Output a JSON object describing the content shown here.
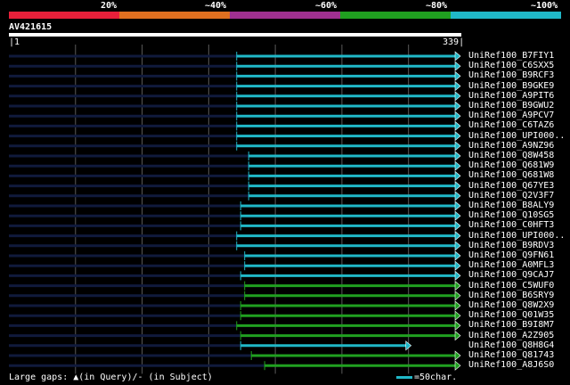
{
  "legend": {
    "labels": [
      "20%",
      "~40%",
      "~60%",
      "~80%",
      "~100%"
    ],
    "colors": [
      "#e8203a",
      "#e07020",
      "#a03090",
      "#20a020",
      "#20b8c8"
    ]
  },
  "query": {
    "name": "AV421615",
    "start": "1",
    "end": "339"
  },
  "colors": {
    "teal": "#20b8c8",
    "green": "#20a020",
    "gap": "#101a3c",
    "grid": "#5a5a5a",
    "query_bar": "#ffffff"
  },
  "hits": [
    {
      "name": "UniRef100_B7FIY1",
      "color": "teal",
      "start": 171,
      "arrow": true
    },
    {
      "name": "UniRef100_C6SXX5",
      "color": "teal",
      "start": 171,
      "arrow": true
    },
    {
      "name": "UniRef100_B9RCF3",
      "color": "teal",
      "start": 171,
      "arrow": true
    },
    {
      "name": "UniRef100_B9GKE9",
      "color": "teal",
      "start": 171,
      "arrow": true
    },
    {
      "name": "UniRef100_A9PIT6",
      "color": "teal",
      "start": 171,
      "arrow": true
    },
    {
      "name": "UniRef100_B9GWU2",
      "color": "teal",
      "start": 171,
      "arrow": true
    },
    {
      "name": "UniRef100_A9PCV7",
      "color": "teal",
      "start": 171,
      "arrow": true
    },
    {
      "name": "UniRef100_C6TAZ6",
      "color": "teal",
      "start": 171,
      "arrow": true
    },
    {
      "name": "UniRef100_UPI000..",
      "color": "teal",
      "start": 171,
      "arrow": true
    },
    {
      "name": "UniRef100_A9NZ96",
      "color": "teal",
      "start": 171,
      "arrow": true
    },
    {
      "name": "UniRef100_Q8W458",
      "color": "teal",
      "start": 180,
      "arrow": true
    },
    {
      "name": "UniRef100_Q681W9",
      "color": "teal",
      "start": 180,
      "arrow": true
    },
    {
      "name": "UniRef100_Q681W8",
      "color": "teal",
      "start": 180,
      "arrow": true
    },
    {
      "name": "UniRef100_Q67YE3",
      "color": "teal",
      "start": 180,
      "arrow": true
    },
    {
      "name": "UniRef100_Q2V3F7",
      "color": "teal",
      "start": 180,
      "arrow": true
    },
    {
      "name": "UniRef100_B8ALY9",
      "color": "teal",
      "start": 174,
      "arrow": true
    },
    {
      "name": "UniRef100_Q10SG5",
      "color": "teal",
      "start": 174,
      "arrow": true
    },
    {
      "name": "UniRef100_C0HFT3",
      "color": "teal",
      "start": 174,
      "arrow": true
    },
    {
      "name": "UniRef100_UPI000..",
      "color": "teal",
      "start": 171,
      "arrow": true
    },
    {
      "name": "UniRef100_B9RDV3",
      "color": "teal",
      "start": 171,
      "arrow": true
    },
    {
      "name": "UniRef100_Q9FN61",
      "color": "teal",
      "start": 177,
      "arrow": true
    },
    {
      "name": "UniRef100_A0MFL3",
      "color": "teal",
      "start": 177,
      "arrow": true
    },
    {
      "name": "UniRef100_Q9CAJ7",
      "color": "teal",
      "start": 174,
      "arrow": true
    },
    {
      "name": "UniRef100_C5WUF0",
      "color": "green",
      "start": 177,
      "arrow": true
    },
    {
      "name": "UniRef100_B6SRY9",
      "color": "green",
      "start": 177,
      "arrow": true
    },
    {
      "name": "UniRef100_Q8W2X9",
      "color": "green",
      "start": 174,
      "arrow": true
    },
    {
      "name": "UniRef100_Q01W35",
      "color": "green",
      "start": 174,
      "arrow": true
    },
    {
      "name": "UniRef100_B9I8M7",
      "color": "green",
      "start": 171,
      "arrow": true
    },
    {
      "name": "UniRef100_A2Z905",
      "color": "green",
      "start": 174,
      "arrow": true
    },
    {
      "name": "UniRef100_Q8H8G4",
      "color": "teal",
      "start": 174,
      "end": 302,
      "arrow": true
    },
    {
      "name": "UniRef100_Q81743",
      "color": "green",
      "start": 182,
      "arrow": true
    },
    {
      "name": "UniRef100_A8J6S0",
      "color": "green",
      "start": 192,
      "arrow": true
    }
  ],
  "footer": {
    "gaps_text": "Large gaps: ▲(in Query)/- (in Subject)",
    "scale_text": "=50char."
  }
}
